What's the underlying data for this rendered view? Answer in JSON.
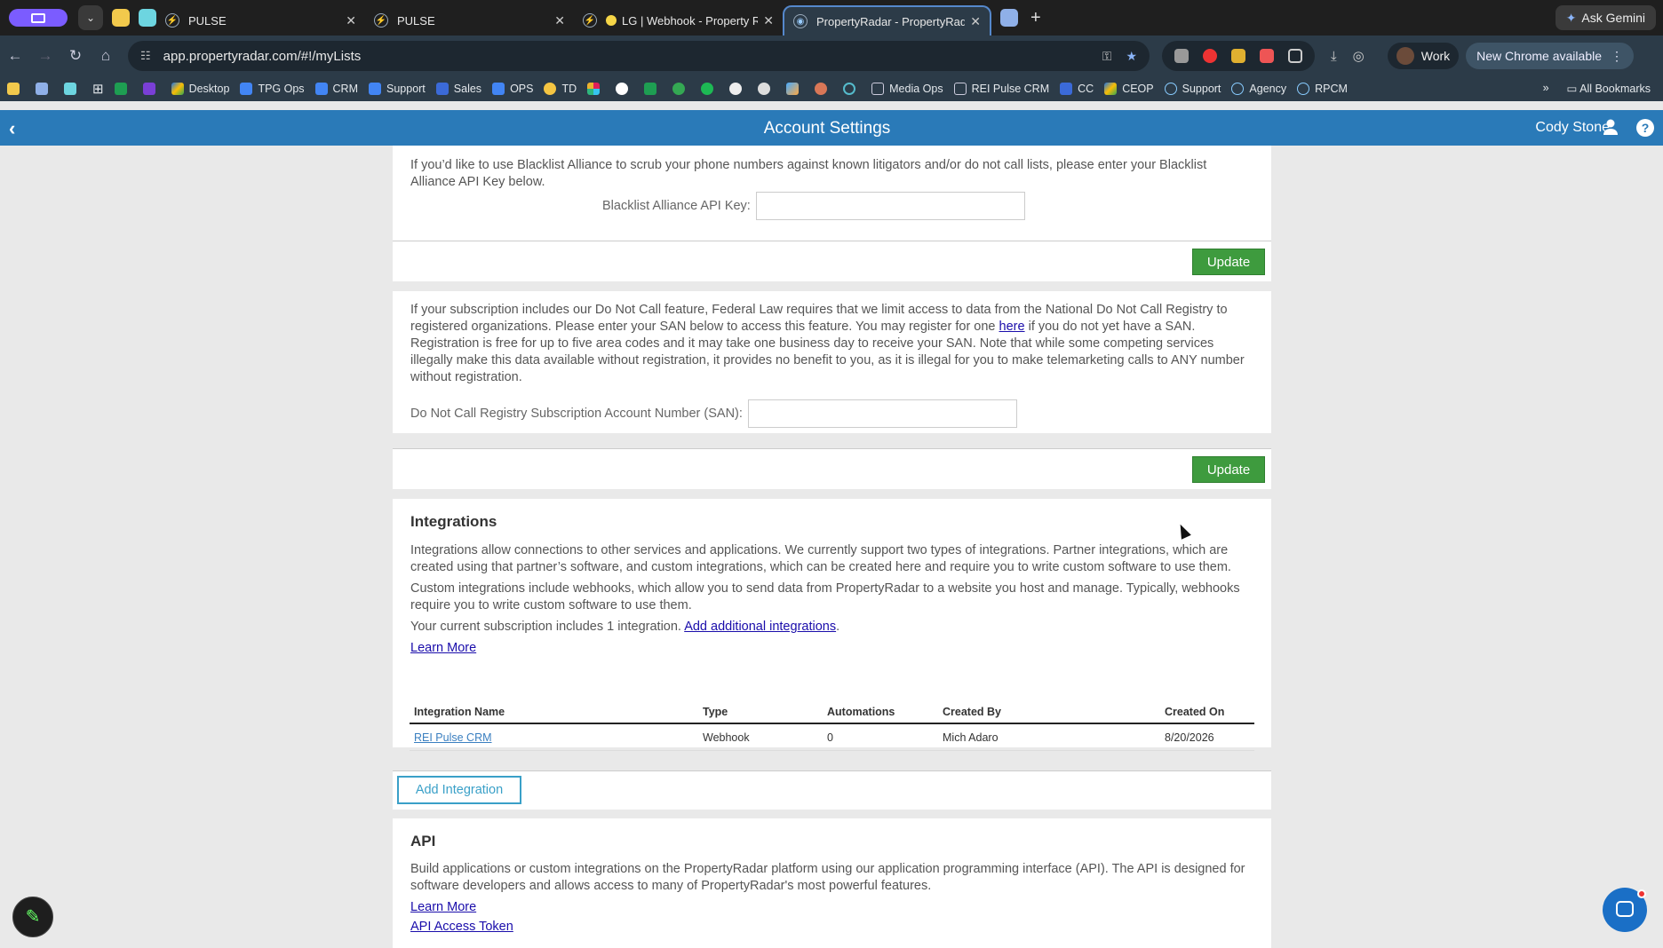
{
  "browser": {
    "tabs": [
      {
        "title": "PULSE"
      },
      {
        "title": "PULSE"
      },
      {
        "title": "LG | Webhook - Property R"
      },
      {
        "title": "PropertyRadar - PropertyRad",
        "active": true
      }
    ],
    "ask_gemini": "Ask Gemini",
    "url": "app.propertyradar.com/#!/myLists",
    "profile_label": "Work",
    "update_label": "New Chrome available",
    "bookmarks": [
      "Desktop",
      "TPG Ops",
      "CRM",
      "Support",
      "Sales",
      "OPS",
      "TD",
      "Media Ops",
      "REI Pulse CRM",
      "CC",
      "CEOP",
      "Support",
      "Agency",
      "RPCM"
    ],
    "all_bookmarks": "All Bookmarks",
    "overflow": "»"
  },
  "app": {
    "title": "Account Settings",
    "user": "Cody Stone",
    "help": "?"
  },
  "blacklist": {
    "text": "If you’d like to use Blacklist Alliance to scrub your phone numbers against known litigators and/or do not call lists, please enter your Blacklist Alliance API Key below.",
    "label": "Blacklist Alliance API Key:",
    "update": "Update"
  },
  "dnc": {
    "text_before": "If your subscription includes our Do Not Call feature, Federal Law requires that we limit access to data from the National Do Not Call Registry to registered organizations. Please enter your SAN below to access this feature. You may register for one ",
    "link": "here",
    "text_after": " if you do not yet have a SAN. Registration is free for up to five area codes and it may take one business day to receive your SAN. Note that while some competing services illegally make this data available without registration, it provides no benefit to you, as it is illegal for you to make telemarketing calls to ANY number without registration.",
    "label": "Do Not Call Registry Subscription Account Number (SAN):",
    "update": "Update"
  },
  "integrations": {
    "heading": "Integrations",
    "p1": "Integrations allow connections to other services and applications. We currently support two types of integrations. Partner integrations, which are created using that partner’s software, and custom integrations, which can be created here and require you to write custom software to use them.",
    "p2": "Custom integrations include webhooks, which allow you to send data from PropertyRadar to a website you host and manage. Typically, webhooks require you to write custom software to use them.",
    "p3_before": "Your current subscription includes 1 integration. ",
    "p3_link": "Add additional integrations",
    "p3_after": ".",
    "learn_more": "Learn More",
    "columns": [
      "Integration Name",
      "Type",
      "Automations",
      "Created By",
      "Created On"
    ],
    "rows": [
      {
        "name": "REI Pulse CRM",
        "type": "Webhook",
        "automations": "0",
        "created_by": "Mich Adaro",
        "created_on": "8/20/2026"
      }
    ],
    "add_button": "Add Integration"
  },
  "api": {
    "heading": "API",
    "text": "Build applications or custom integrations on the PropertyRadar platform using our application programming interface (API). The API is designed for software developers and allows access to many of PropertyRadar's most powerful features.",
    "learn_more": "Learn More",
    "token": "API Access Token"
  },
  "colors": {
    "appbar": "#2a7ab8",
    "update_green": "#3e9b3e",
    "link": "#1a0dab"
  }
}
